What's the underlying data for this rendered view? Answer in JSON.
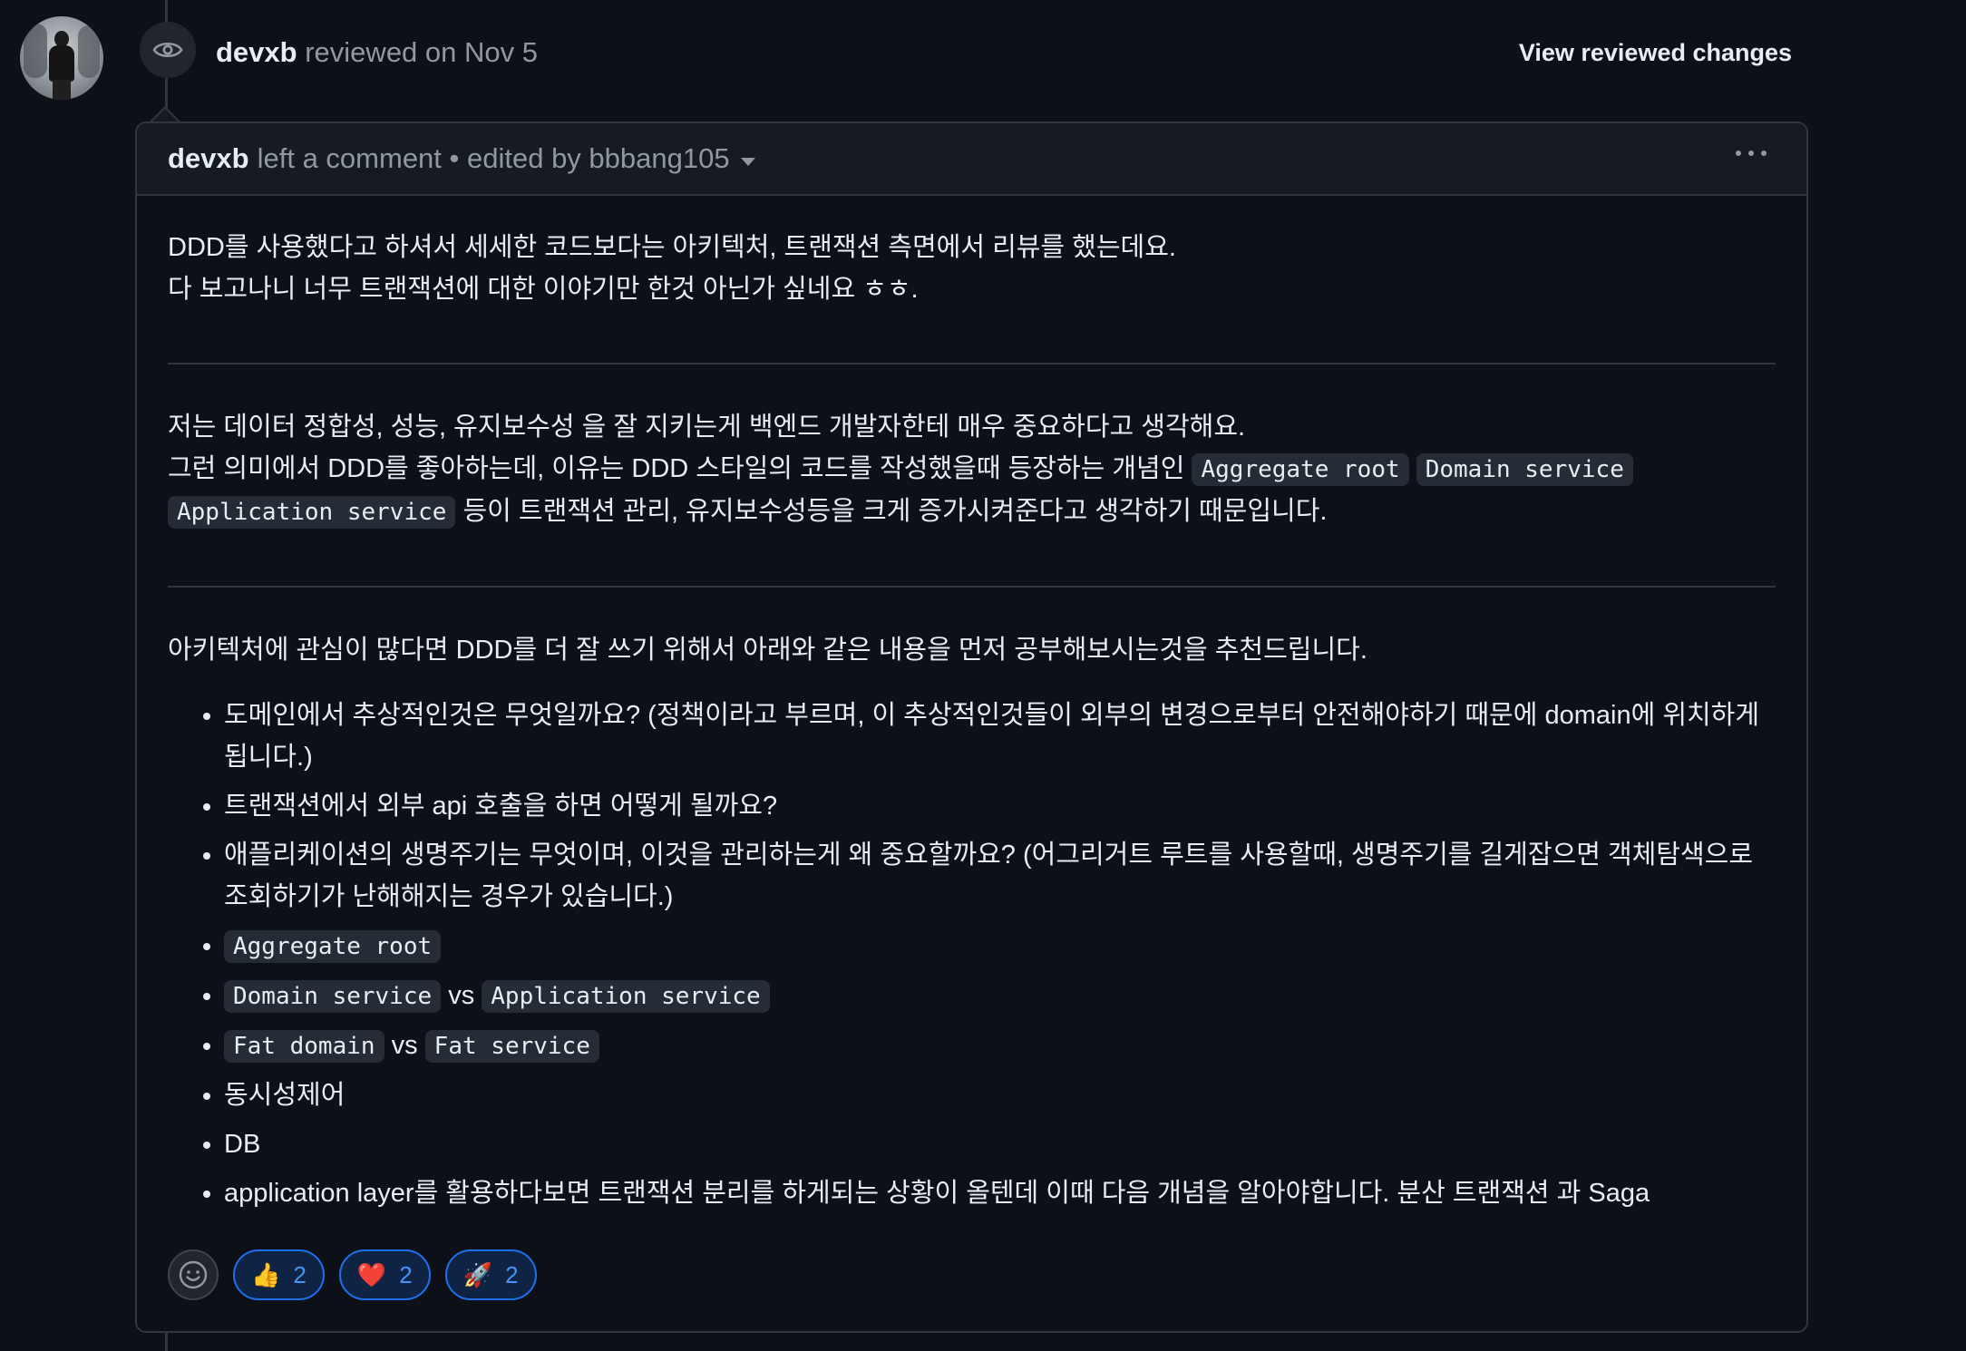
{
  "event": {
    "author": "devxb",
    "action": "reviewed on Nov 5",
    "view_changes": "View reviewed changes"
  },
  "comment": {
    "author": "devxb",
    "meta": "left a comment • edited by bbbang105",
    "paragraph1": {
      "line1": "DDD를 사용했다고 하셔서 세세한 코드보다는 아키텍처, 트랜잭션 측면에서 리뷰를 했는데요.",
      "line2": "다 보고나니 너무 트랜잭션에 대한 이야기만 한것 아닌가 싶네요 ㅎㅎ."
    },
    "paragraph2": {
      "line1": "저는 데이터 정합성, 성능, 유지보수성 을 잘 지키는게 백엔드 개발자한테 매우 중요하다고 생각해요.",
      "line2_prefix": "그런 의미에서 DDD를 좋아하는데, 이유는 DDD 스타일의 코드를 작성했을때 등장하는 개념인",
      "code1": "Aggregate root",
      "code2": "Domain service",
      "code3": "Application service",
      "line3_suffix": "등이 트랜잭션 관리, 유지보수성등을 크게 증가시켜준다고 생각하기 때문입니다."
    },
    "paragraph3": "아키텍처에 관심이 많다면 DDD를 더 잘 쓰기 위해서 아래와 같은 내용을 먼저 공부해보시는것을 추천드립니다.",
    "topics": {
      "item1": "도메인에서 추상적인것은 무엇일까요? (정책이라고 부르며, 이 추상적인것들이 외부의 변경으로부터 안전해야하기 때문에 domain에 위치하게 됩니다.)",
      "item2": "트랜잭션에서 외부 api 호출을 하면 어떻게 될까요?",
      "item3": "애플리케이션의 생명주기는 무엇이며, 이것을 관리하는게 왜 중요할까요? (어그리거트 루트를 사용할때, 생명주기를 길게잡으면 객체탐색으로 조회하기가 난해해지는 경우가 있습니다.)",
      "item4_code": "Aggregate root",
      "item5_code_a": "Domain service",
      "item5_vs": "vs",
      "item5_code_b": "Application service",
      "item6_code_a": "Fat domain",
      "item6_vs": "vs",
      "item6_code_b": "Fat service",
      "item7": "동시성제어",
      "item8": "DB",
      "item9": "application layer를 활용하다보면 트랜잭션 분리를 하게되는 상황이 올텐데 이때 다음 개념을 알아야합니다. 분산 트랜잭션 과 Saga"
    }
  },
  "reactions": [
    {
      "emoji": "👍",
      "count": "2"
    },
    {
      "emoji": "❤️",
      "count": "2"
    },
    {
      "emoji": "🚀",
      "count": "2"
    }
  ],
  "colors": {
    "background": "#0d1117",
    "header_bg": "#161b22",
    "border": "#30363d",
    "reaction_accent": "#4493f8"
  }
}
